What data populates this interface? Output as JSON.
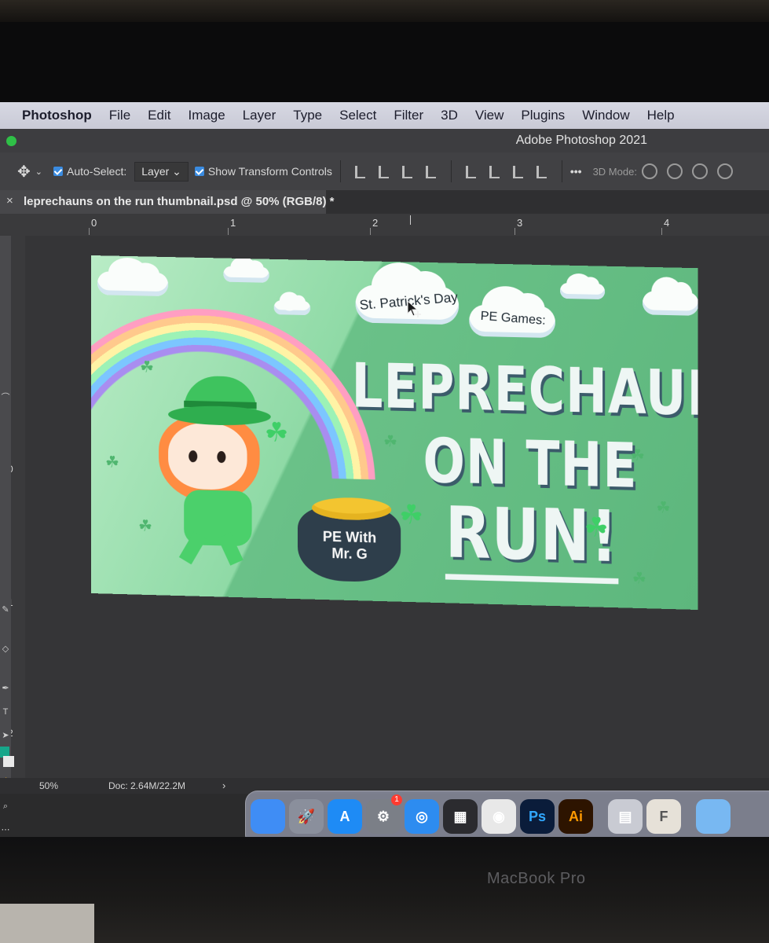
{
  "menubar": {
    "app_name": "Photoshop",
    "items": [
      "File",
      "Edit",
      "Image",
      "Layer",
      "Type",
      "Select",
      "Filter",
      "3D",
      "View",
      "Plugins",
      "Window",
      "Help"
    ]
  },
  "window": {
    "title": "Adobe Photoshop 2021"
  },
  "options_bar": {
    "auto_select_label": "Auto-Select:",
    "auto_select_target": "Layer",
    "show_transform_label": "Show Transform Controls",
    "more_label": "•••",
    "mode_3d_label": "3D Mode:"
  },
  "document_tab": {
    "close": "×",
    "label": "leprechauns on the run thumbnail.psd @ 50% (RGB/8) *"
  },
  "ruler_top": [
    "0",
    "1",
    "2",
    "3",
    "4"
  ],
  "ruler_left": [
    "0",
    "1",
    "2",
    "3"
  ],
  "artwork": {
    "badge_1": "St. Patrick's Day",
    "badge_2": "PE Games:",
    "title_line_1": "LEPRECHAUNS",
    "title_line_2": "ON THE",
    "title_line_3": "RUN!",
    "pot_text_1": "PE With",
    "pot_text_2": "Mr. G"
  },
  "status_bar": {
    "zoom": "50%",
    "doc_size": "Doc: 2.64M/22.2M",
    "arrow": "›"
  },
  "dock": {
    "items": [
      {
        "name": "finder",
        "label": "",
        "color": "#3f8df5"
      },
      {
        "name": "launchpad",
        "label": "🚀",
        "color": "#8a8f9c"
      },
      {
        "name": "app-store",
        "label": "A",
        "color": "#1e8bf5"
      },
      {
        "name": "system-preferences",
        "label": "⚙",
        "color": "#7b7f87"
      },
      {
        "name": "safari",
        "label": "◎",
        "color": "#2d8cf0"
      },
      {
        "name": "final-cut",
        "label": "▦",
        "color": "#2b2b2f"
      },
      {
        "name": "chrome",
        "label": "◉",
        "color": "#e8e8e8"
      },
      {
        "name": "photoshop",
        "label": "Ps",
        "color": "#0a1c3a"
      },
      {
        "name": "illustrator",
        "label": "Ai",
        "color": "#2d1400"
      },
      {
        "name": "preview",
        "label": "▤",
        "color": "#c9cbd3"
      },
      {
        "name": "font-book",
        "label": "F",
        "color": "#e6e1d8"
      },
      {
        "name": "folder",
        "label": "",
        "color": "#78b8f2"
      }
    ],
    "notification_badge": "1"
  },
  "hardware_label": "MacBook Pro"
}
